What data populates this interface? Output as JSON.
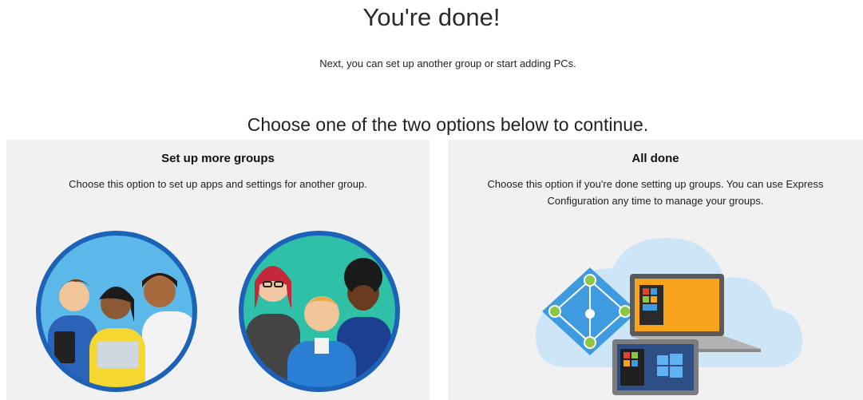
{
  "header": {
    "title": "You're done!",
    "subtitle": "Next, you can set up another group or start adding PCs."
  },
  "prompt": "Choose one of the two options below to continue.",
  "options": [
    {
      "title": "Set up more groups",
      "description": "Choose this option to set up apps and settings for another group."
    },
    {
      "title": "All done",
      "description": "Choose this option if you're done setting up groups. You can use Express Configuration any time to manage your groups."
    }
  ],
  "colors": {
    "card_background": "#f1f1f1",
    "circle_border": "#1c62b9",
    "accent_orange": "#f7a21b",
    "cloud": "#cde6f7"
  },
  "icons": [
    "people-group-icon",
    "people-group-icon",
    "azure-ad-icon",
    "laptop-icon",
    "tablet-icon",
    "cloud-icon"
  ]
}
